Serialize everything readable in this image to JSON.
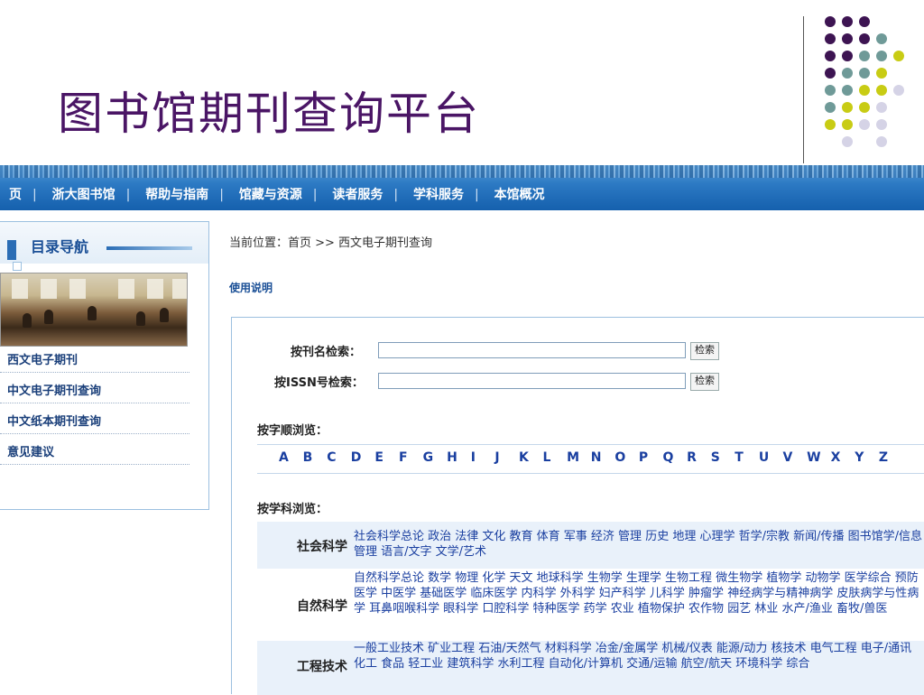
{
  "slide": {
    "title": "图书馆期刊查询平台"
  },
  "nav": {
    "items": [
      "页",
      "浙大图书馆",
      "帮助与指南",
      "馆藏与资源",
      "读者服务",
      "学科服务",
      "本馆概况"
    ]
  },
  "sidebar": {
    "title": "目录导航",
    "links": [
      "西文电子期刊",
      "中文电子期刊查询",
      "中文纸本期刊查询",
      "意见建议"
    ]
  },
  "breadcrumb": "当前位置：首页 >> 西文电子期刊查询",
  "usage_link": "使用说明",
  "search": {
    "title_label": "按刊名检索：",
    "issn_label": "按ISSN号检索：",
    "button": "检索",
    "title_value": "",
    "issn_value": ""
  },
  "browse_alpha": {
    "label": "按字顺浏览：",
    "letters": [
      "A",
      "B",
      "C",
      "D",
      "E",
      "F",
      "G",
      "H",
      "I",
      "J",
      "K",
      "L",
      "M",
      "N",
      "O",
      "P",
      "Q",
      "R",
      "S",
      "T",
      "U",
      "V",
      "W",
      "X",
      "Y",
      "Z"
    ]
  },
  "browse_subject": {
    "label": "按学科浏览：",
    "groups": [
      {
        "name": "社会科学",
        "items": "社会科学总论 政治 法律 文化 教育 体育 军事 经济 管理 历史 地理 心理学 哲学/宗教 新闻/传播 图书馆学/信息管理 语言/文字 文学/艺术"
      },
      {
        "name": "自然科学",
        "items": "自然科学总论 数学 物理 化学 天文 地球科学 生物学 生理学 生物工程 微生物学 植物学 动物学 医学综合 预防医学 中医学 基础医学 临床医学 内科学 外科学 妇产科学 儿科学 肿瘤学 神经病学与精神病学 皮肤病学与性病学 耳鼻咽喉科学 眼科学 口腔科学 特种医学 药学 农业 植物保护 农作物 园艺 林业 水产/渔业 畜牧/兽医"
      },
      {
        "name": "工程技术",
        "items": "一般工业技术 矿业工程 石油/天然气 材料科学 冶金/金属学 机械/仪表 能源/动力 核技术 电气工程 电子/通讯 化工 食品 轻工业 建筑科学 水利工程 自动化/计算机 交通/运输 航空/航天 环境科学 综合"
      }
    ]
  },
  "colors": {
    "title": "#4a1565",
    "nav": "#1e6ab6",
    "link": "#1a3fa0",
    "dot_purple": "#3d1452",
    "dot_teal": "#6f9a98",
    "dot_yellow": "#c8cc14",
    "dot_lilac": "#d5d3e6"
  }
}
